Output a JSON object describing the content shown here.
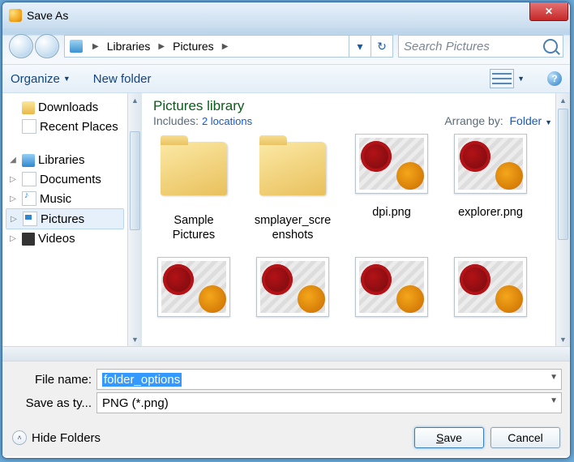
{
  "window": {
    "title": "Save As"
  },
  "nav": {
    "breadcrumb": [
      "Libraries",
      "Pictures"
    ],
    "search_placeholder": "Search Pictures"
  },
  "toolbar": {
    "organize": "Organize",
    "new_folder": "New folder"
  },
  "sidebar": {
    "downloads": "Downloads",
    "recent": "Recent Places",
    "libraries": "Libraries",
    "documents": "Documents",
    "music": "Music",
    "pictures": "Pictures",
    "videos": "Videos"
  },
  "content": {
    "library_title": "Pictures library",
    "includes_label": "Includes:",
    "includes_link": "2 locations",
    "arrange_label": "Arrange by:",
    "arrange_value": "Folder",
    "items": [
      {
        "type": "folder",
        "label": "Sample Pictures"
      },
      {
        "type": "folder",
        "label": "smplayer_screenshots"
      },
      {
        "type": "image",
        "label": "dpi.png"
      },
      {
        "type": "image",
        "label": "explorer.png"
      }
    ]
  },
  "form": {
    "filename_label": "File name:",
    "filename_value": "folder_options",
    "type_label": "Save as type:",
    "type_value": "PNG (*.png)"
  },
  "footer": {
    "hide_folders": "Hide Folders",
    "save": "Save",
    "cancel": "Cancel"
  }
}
